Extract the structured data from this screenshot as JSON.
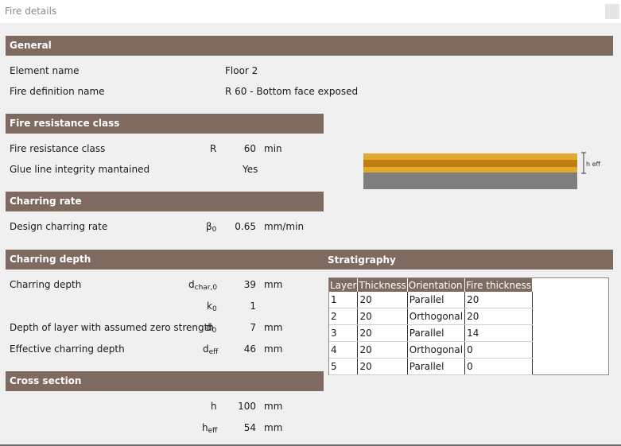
{
  "window": {
    "title": "Fire details"
  },
  "general": {
    "header": "General",
    "element_name_label": "Element name",
    "element_name_value": "Floor 2",
    "fire_definition_label": "Fire definition name",
    "fire_definition_value": "R 60 - Bottom face exposed"
  },
  "fire_resistance": {
    "header": "Fire resistance class",
    "class_label": "Fire resistance class",
    "class_symbol": "R",
    "class_value": "60",
    "class_unit": "min",
    "glue_label": "Glue line integrity mantained",
    "glue_value": "Yes"
  },
  "charring_rate": {
    "header": "Charring rate",
    "design_label": "Design charring rate",
    "design_symbol_main": "β",
    "design_symbol_sub": "0",
    "design_value": "0.65",
    "design_unit": "mm/min"
  },
  "charring_depth": {
    "header": "Charring depth",
    "depth_label": "Charring depth",
    "depth_symbol_main": "d",
    "depth_symbol_sub": "char,0",
    "depth_value": "39",
    "depth_unit": "mm",
    "k0_symbol_main": "k",
    "k0_symbol_sub": "0",
    "k0_value": "1",
    "zero_label": "Depth of layer with assumed zero strength",
    "zero_symbol_main": "d",
    "zero_symbol_sub": "0",
    "zero_value": "7",
    "zero_unit": "mm",
    "eff_label": "Effective charring depth",
    "eff_symbol_main": "d",
    "eff_symbol_sub": "eff",
    "eff_value": "46",
    "eff_unit": "mm"
  },
  "cross_section": {
    "header": "Cross section",
    "h_symbol": "h",
    "h_value": "100",
    "h_unit": "mm",
    "heff_symbol_main": "h",
    "heff_symbol_sub": "eff",
    "heff_value": "54",
    "heff_unit": "mm"
  },
  "diagram": {
    "label": "h eff",
    "colors": {
      "gold": "#e2a92d",
      "dark_gold": "#c07d12",
      "gray": "#7e7e7e"
    }
  },
  "stratigraphy": {
    "header": "Stratigraphy",
    "columns": [
      "Layer",
      "Thickness",
      "Orientation",
      "Fire thickness"
    ],
    "rows": [
      [
        "1",
        "20",
        "Parallel",
        "20"
      ],
      [
        "2",
        "20",
        "Orthogonal",
        "20"
      ],
      [
        "3",
        "20",
        "Parallel",
        "14"
      ],
      [
        "4",
        "20",
        "Orthogonal",
        "0"
      ],
      [
        "5",
        "20",
        "Parallel",
        "0"
      ]
    ]
  },
  "colors": {
    "header_bg": "#7e6a5f",
    "page_bg": "#f0f0f0"
  }
}
